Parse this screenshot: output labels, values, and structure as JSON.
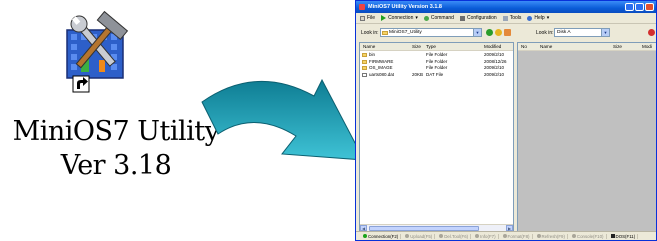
{
  "desktop_shortcut": {
    "name": "MiniOS7 Utility",
    "version": "Ver 3.18",
    "icon": "minios7-utility-shortcut-icon"
  },
  "window": {
    "title": "MiniOS7 Utility Version 3.1.8",
    "controls": [
      "minimize",
      "maximize",
      "close"
    ]
  },
  "menu": [
    {
      "label": "File",
      "icon": "file-icon"
    },
    {
      "label": "Connection",
      "icon": "play-icon"
    },
    {
      "label": "Command",
      "icon": "command-icon"
    },
    {
      "label": "Configuration",
      "icon": "config-icon"
    },
    {
      "label": "Tools",
      "icon": "tools-icon"
    },
    {
      "label": "Help",
      "icon": "help-icon"
    }
  ],
  "left_panel": {
    "look_in_label": "Look in:",
    "look_in_value": "MiniOS7_Utility",
    "columns": [
      "Name",
      "Size",
      "Type",
      "Modified"
    ],
    "rows": [
      {
        "name": "bin",
        "size": "",
        "type": "File Folder",
        "modified": "2009/2/10",
        "kind": "folder"
      },
      {
        "name": "FIRMWARE",
        "size": "",
        "type": "File Folder",
        "modified": "2008/12/26",
        "kind": "folder"
      },
      {
        "name": "OS_IMAGE",
        "size": "",
        "type": "File Folder",
        "modified": "2009/2/10",
        "kind": "folder"
      },
      {
        "name": "uarts080.dat",
        "size": "20KB",
        "type": "DAT File",
        "modified": "2009/2/10",
        "kind": "file"
      }
    ]
  },
  "right_panel": {
    "look_in_label": "Look in:",
    "look_in_value": "Disk A",
    "columns": [
      "No",
      "Name",
      "Size",
      "Modi"
    ]
  },
  "status_tabs": [
    {
      "label": "Connection(F2)",
      "active": true
    },
    {
      "label": "Upload(F5)",
      "active": false
    },
    {
      "label": "Del.Tool(F6)",
      "active": false
    },
    {
      "label": "Info(F7)",
      "active": false
    },
    {
      "label": "Format(F8)",
      "active": false
    },
    {
      "label": "Refresh(F9)",
      "active": false
    },
    {
      "label": "Console(F10)",
      "active": false
    },
    {
      "label": "DOS(F11)",
      "active": false
    }
  ],
  "colors": {
    "titlebar": "#0a5cd8",
    "window_bg": "#ece9d8",
    "right_pane_bg": "#c0c0c0",
    "arrow_top": "#0e7d93",
    "arrow_bottom": "#3fc3d6"
  }
}
